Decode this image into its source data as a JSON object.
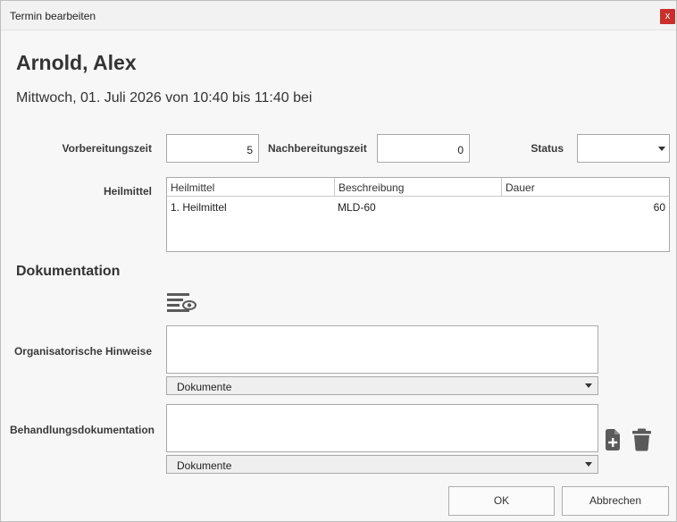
{
  "window": {
    "title": "Termin bearbeiten",
    "close_label": "x"
  },
  "header": {
    "patient_name": "Arnold, Alex",
    "appointment_info": "Mittwoch, 01. Juli 2026 von 10:40 bis 11:40 bei"
  },
  "fields": {
    "vorbereitungszeit_label": "Vorbereitungszeit",
    "vorbereitungszeit_value": "5",
    "nachbereitungszeit_label": "Nachbereitungszeit",
    "nachbereitungszeit_value": "0",
    "status_label": "Status",
    "status_value": ""
  },
  "heilmittel": {
    "label": "Heilmittel",
    "columns": [
      "Heilmittel",
      "Beschreibung",
      "Dauer"
    ],
    "rows": [
      [
        "1. Heilmittel",
        "MLD-60",
        "60"
      ]
    ]
  },
  "dokumentation": {
    "title": "Dokumentation",
    "org_hinweise_label": "Organisatorische Hinweise",
    "org_hinweise_value": "",
    "org_dokumente_label": "Dokumente",
    "behandlung_label": "Behandlungsdokumentation",
    "behandlung_value": "",
    "behandlung_dokumente_label": "Dokumente",
    "icons": [
      "text-preview-icon",
      "add-document-icon",
      "trash-icon"
    ]
  },
  "buttons": {
    "ok": "OK",
    "cancel": "Abbrechen"
  },
  "colors": {
    "close": "#c9302c",
    "icon": "#5a5a5a",
    "border": "#a9a9a9"
  }
}
